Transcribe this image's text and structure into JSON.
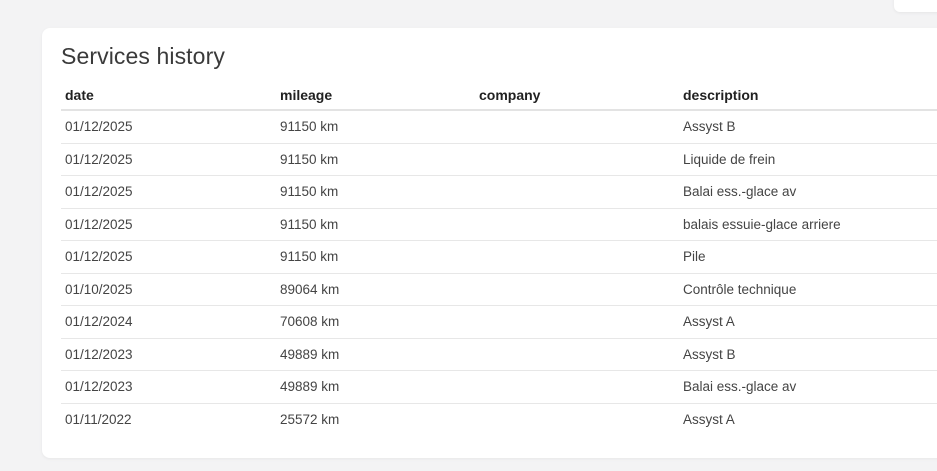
{
  "section": {
    "title": "Services history"
  },
  "table": {
    "headers": {
      "date": "date",
      "mileage": "mileage",
      "company": "company",
      "description": "description"
    },
    "rows": [
      {
        "date": "01/12/2025",
        "mileage": "91150 km",
        "company": "",
        "description": "Assyst B"
      },
      {
        "date": "01/12/2025",
        "mileage": "91150 km",
        "company": "",
        "description": "Liquide de frein"
      },
      {
        "date": "01/12/2025",
        "mileage": "91150 km",
        "company": "",
        "description": "Balai ess.-glace av"
      },
      {
        "date": "01/12/2025",
        "mileage": "91150 km",
        "company": "",
        "description": "balais essuie-glace arriere"
      },
      {
        "date": "01/12/2025",
        "mileage": "91150 km",
        "company": "",
        "description": "Pile"
      },
      {
        "date": "01/10/2025",
        "mileage": "89064 km",
        "company": "",
        "description": "Contrôle technique"
      },
      {
        "date": "01/12/2024",
        "mileage": "70608 km",
        "company": "",
        "description": "Assyst A"
      },
      {
        "date": "01/12/2023",
        "mileage": "49889 km",
        "company": "",
        "description": "Assyst B"
      },
      {
        "date": "01/12/2023",
        "mileage": "49889 km",
        "company": "",
        "description": "Balai ess.-glace av"
      },
      {
        "date": "01/11/2022",
        "mileage": "25572 km",
        "company": "",
        "description": "Assyst A"
      }
    ]
  },
  "colors": {
    "page_background": "#f3f3f4",
    "card_background": "#ffffff",
    "header_text": "#212121",
    "body_text": "#444444",
    "row_divider": "#e7e7e7"
  }
}
